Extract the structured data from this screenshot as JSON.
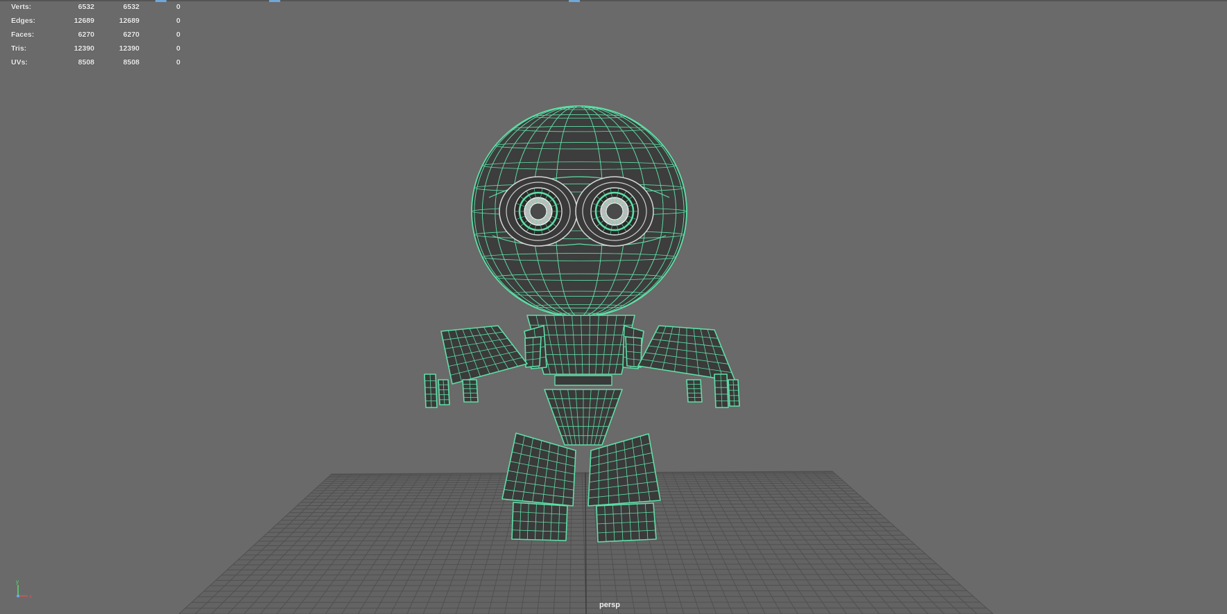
{
  "viewport": {
    "camera_label": "persp",
    "wireframe_color": "#5fe0a8",
    "background_color": "#6a6a6a",
    "grid_color": "#505050"
  },
  "heads_up_display": {
    "rows": [
      {
        "label": "Verts:",
        "a": "6532",
        "b": "6532",
        "c": "0"
      },
      {
        "label": "Edges:",
        "a": "12689",
        "b": "12689",
        "c": "0"
      },
      {
        "label": "Faces:",
        "a": "6270",
        "b": "6270",
        "c": "0"
      },
      {
        "label": "Tris:",
        "a": "12390",
        "b": "12390",
        "c": "0"
      },
      {
        "label": "UVs:",
        "a": "8508",
        "b": "8508",
        "c": "0"
      }
    ]
  },
  "axis_gizmo": {
    "y_label": "y",
    "x_label": "x",
    "y_color": "#55e06a",
    "x_color": "#e05050",
    "z_color": "#6fa8ff"
  }
}
